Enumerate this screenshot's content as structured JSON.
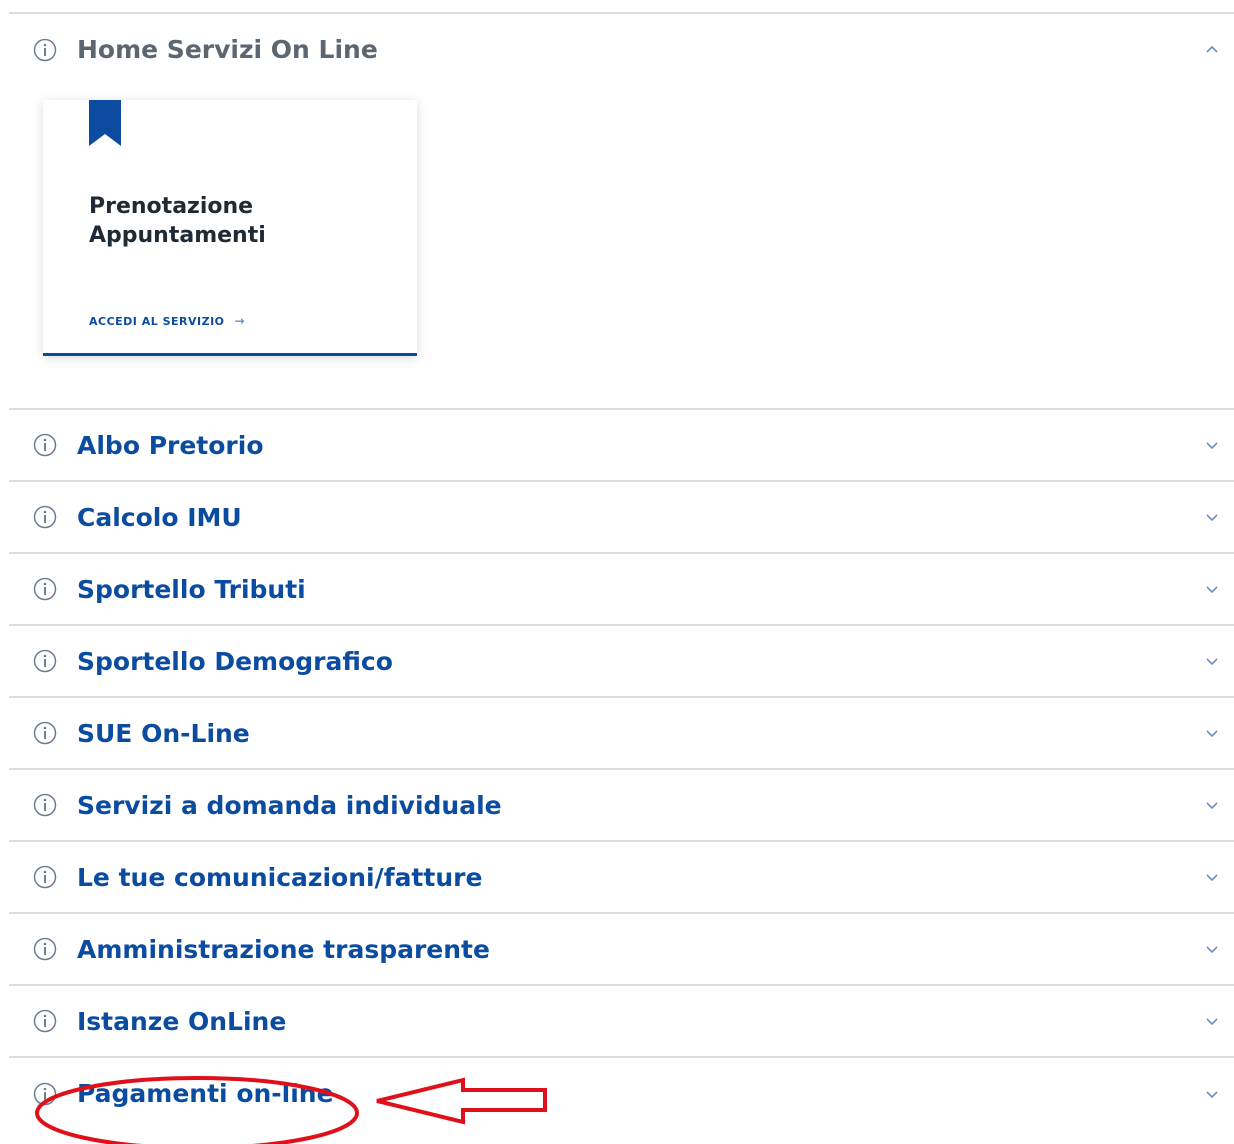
{
  "colors": {
    "primary": "#0b4ca0",
    "muted_title": "#5b6670",
    "divider": "#dcdcdc",
    "annotation": "#e0101a"
  },
  "accordion": {
    "expanded": {
      "title": "Home Servizi On Line",
      "icon": "info-icon",
      "toggle_icon": "chevron-up-icon",
      "card": {
        "icon": "bookmark-icon",
        "title": "Prenotazione Appuntamenti",
        "link_label": "ACCEDI AL SERVIZIO",
        "link_icon": "arrow-right-icon"
      }
    },
    "items": [
      {
        "title": "Albo Pretorio",
        "icon": "info-icon"
      },
      {
        "title": "Calcolo IMU",
        "icon": "info-icon"
      },
      {
        "title": "Sportello Tributi",
        "icon": "info-icon"
      },
      {
        "title": "Sportello Demografico",
        "icon": "info-icon"
      },
      {
        "title": "SUE On-Line",
        "icon": "info-icon"
      },
      {
        "title": "Servizi a domanda individuale",
        "icon": "info-icon"
      },
      {
        "title": "Le tue comunicazioni/fatture",
        "icon": "info-icon"
      },
      {
        "title": "Amministrazione trasparente",
        "icon": "info-icon"
      },
      {
        "title": "Istanze OnLine",
        "icon": "info-icon"
      },
      {
        "title": "Pagamenti on-line",
        "icon": "info-icon"
      }
    ]
  }
}
